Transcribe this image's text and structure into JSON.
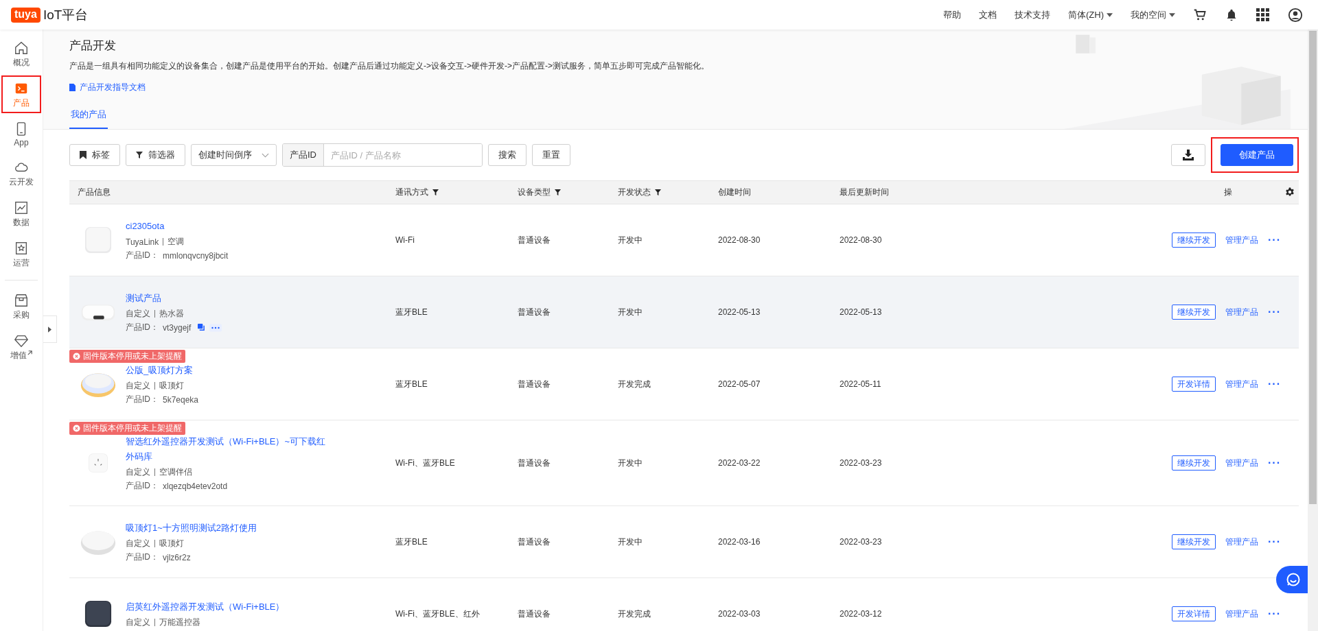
{
  "topbar": {
    "logo": "tuya",
    "title": "IoT平台",
    "nav": [
      {
        "label": "帮助",
        "dropdown": false
      },
      {
        "label": "文档",
        "dropdown": false
      },
      {
        "label": "技术支持",
        "dropdown": false
      },
      {
        "label": "简体(ZH)",
        "dropdown": true
      },
      {
        "label": "我的空间",
        "dropdown": true
      }
    ]
  },
  "sidebar": {
    "items": [
      {
        "label": "概况",
        "selected": false,
        "highlighted": false,
        "external": false
      },
      {
        "label": "产品",
        "selected": true,
        "highlighted": true,
        "external": false
      },
      {
        "label": "App",
        "selected": false,
        "highlighted": false,
        "external": false
      },
      {
        "label": "云开发",
        "selected": false,
        "highlighted": false,
        "external": false
      },
      {
        "label": "数据",
        "selected": false,
        "highlighted": false,
        "external": false
      },
      {
        "label": "运营",
        "selected": false,
        "highlighted": false,
        "external": false
      },
      {
        "label": "采购",
        "selected": false,
        "highlighted": false,
        "external": false
      },
      {
        "label": "增值",
        "selected": false,
        "highlighted": false,
        "external": true
      }
    ]
  },
  "header": {
    "title": "产品开发",
    "description": "产品是一组具有相同功能定义的设备集合，创建产品是使用平台的开始。创建产品后通过功能定义->设备交互->硬件开发->产品配置->测试服务，简单五步即可完成产品智能化。",
    "doc_link": "产品开发指导文档"
  },
  "tabs": [
    {
      "label": "我的产品",
      "selected": true
    }
  ],
  "toolbar": {
    "tag_button": "标签",
    "filter_button": "筛选器",
    "sort": "创建时间倒序",
    "search_prefix": "产品ID",
    "search_placeholder": "产品ID / 产品名称",
    "search_button": "搜索",
    "reset_button": "重置",
    "create_button": "创建产品",
    "create_highlighted": true
  },
  "table": {
    "columns": [
      {
        "label": "产品信息",
        "filter": false
      },
      {
        "label": "通讯方式",
        "filter": true
      },
      {
        "label": "设备类型",
        "filter": true
      },
      {
        "label": "开发状态",
        "filter": true
      },
      {
        "label": "创建时间",
        "filter": false
      },
      {
        "label": "最后更新时间",
        "filter": false
      },
      {
        "label": "操",
        "filter": false
      }
    ],
    "rows": [
      {
        "name": "ci2305ota",
        "source": "TuyaLink",
        "category": "空调",
        "id_label": "产品ID：",
        "id": "mmlonqvcny8jbcit",
        "hovered": false,
        "comm": "Wi-Fi",
        "device_type": "普通设备",
        "status": "开发中",
        "created": "2022-08-30",
        "updated": "2022-08-30",
        "action": "继续开发",
        "manage": "管理产品",
        "more": "···"
      },
      {
        "name": "测试产品",
        "source": "自定义",
        "category": "热水器",
        "id_label": "产品ID：",
        "id": "vt3ygejf",
        "hovered": true,
        "comm": "蓝牙BLE",
        "device_type": "普通设备",
        "status": "开发中",
        "created": "2022-05-13",
        "updated": "2022-05-13",
        "action": "继续开发",
        "manage": "管理产品",
        "more": "···"
      },
      {
        "alert": "固件版本停用或未上架提醒",
        "name": "公版_吸顶灯方案",
        "source": "自定义",
        "category": "吸顶灯",
        "id_label": "产品ID：",
        "id": "5k7eqeka",
        "hovered": false,
        "comm": "蓝牙BLE",
        "device_type": "普通设备",
        "status": "开发完成",
        "created": "2022-05-07",
        "updated": "2022-05-11",
        "action": "开发详情",
        "manage": "管理产品",
        "more": "···"
      },
      {
        "alert": "固件版本停用或未上架提醒",
        "name": "智选红外遥控器开发测试（Wi-Fi+BLE）~可下载红外码库",
        "source": "自定义",
        "category": "空调伴侣",
        "id_label": "产品ID：",
        "id": "xlqezqb4etev2otd",
        "hovered": false,
        "comm": "Wi-Fi、蓝牙BLE",
        "device_type": "普通设备",
        "status": "开发中",
        "created": "2022-03-22",
        "updated": "2022-03-23",
        "action": "继续开发",
        "manage": "管理产品",
        "more": "···"
      },
      {
        "name": "吸顶灯1~十方照明测试2路灯使用",
        "source": "自定义",
        "category": "吸顶灯",
        "id_label": "产品ID：",
        "id": "vjlz6r2z",
        "hovered": false,
        "comm": "蓝牙BLE",
        "device_type": "普通设备",
        "status": "开发中",
        "created": "2022-03-16",
        "updated": "2022-03-23",
        "action": "继续开发",
        "manage": "管理产品",
        "more": "···"
      },
      {
        "name": "启英红外遥控器开发测试（Wi-Fi+BLE）",
        "source": "自定义",
        "category": "万能遥控器",
        "hovered": false,
        "comm": "Wi-Fi、蓝牙BLE、红外",
        "device_type": "普通设备",
        "status": "开发完成",
        "created": "2022-03-03",
        "updated": "2022-03-12",
        "action": "开发详情",
        "manage": "管理产品",
        "more": "···"
      }
    ]
  }
}
